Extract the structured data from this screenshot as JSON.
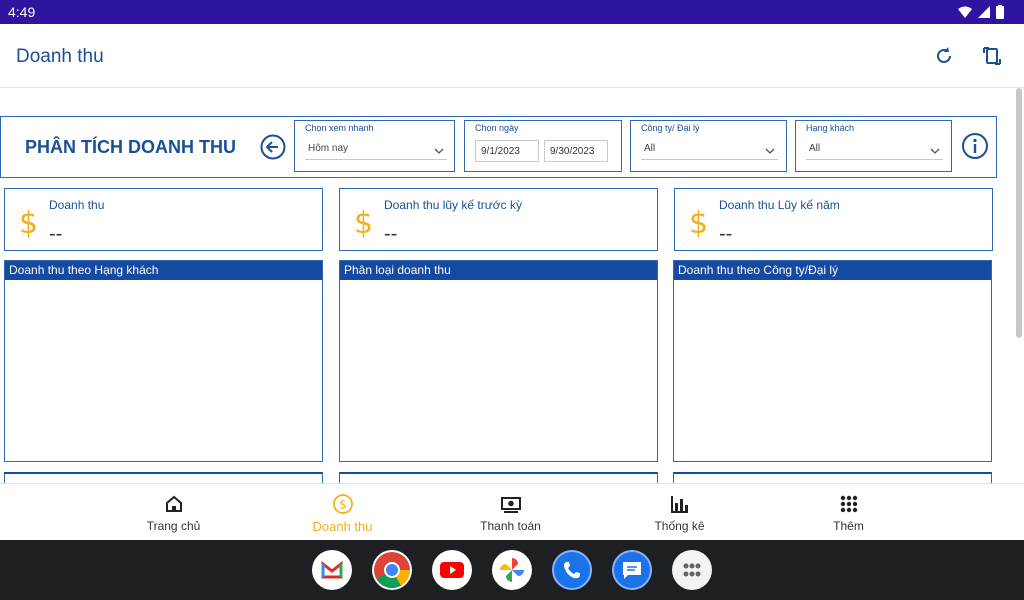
{
  "status_bar": {
    "time": "4:49"
  },
  "app_bar": {
    "title": "Doanh thu"
  },
  "panel": {
    "title": "PHÂN TÍCH DOANH THU",
    "quick_view": {
      "label": "Chọn xem nhanh",
      "value": "Hôm nay"
    },
    "date": {
      "label": "Chọn ngày",
      "from": "9/1/2023",
      "to": "9/30/2023"
    },
    "company": {
      "label": "Công ty/ Đại lý",
      "value": "All"
    },
    "customer_tier": {
      "label": "Hạng khách",
      "value": "All"
    }
  },
  "kpis": [
    {
      "label": "Doanh thu",
      "value": "--"
    },
    {
      "label": "Doanh thu lũy kế trước kỳ",
      "value": "--"
    },
    {
      "label": "Doanh thu Lũy kế năm",
      "value": "--"
    }
  ],
  "charts": [
    {
      "title": "Doanh thu theo Hạng khách"
    },
    {
      "title": "Phân loại doanh thu"
    },
    {
      "title": "Doanh thu theo Công ty/Đại lý"
    }
  ],
  "bottom_nav": [
    {
      "label": "Trang chủ",
      "icon": "home-icon"
    },
    {
      "label": "Doanh thu",
      "icon": "dollar-circle-icon",
      "active": true
    },
    {
      "label": "Thanh toán",
      "icon": "cash-icon"
    },
    {
      "label": "Thống kê",
      "icon": "bar-chart-icon"
    },
    {
      "label": "Thêm",
      "icon": "grid-dots-icon"
    }
  ],
  "dock_apps": [
    "gmail-icon",
    "chrome-icon",
    "youtube-icon",
    "photos-icon",
    "phone-icon",
    "messages-icon",
    "app-drawer-icon"
  ],
  "colors": {
    "primary": "#1b4f96",
    "header_fill": "#164aa0",
    "accent": "#f2b01e",
    "status_bar": "#2f14a0"
  }
}
